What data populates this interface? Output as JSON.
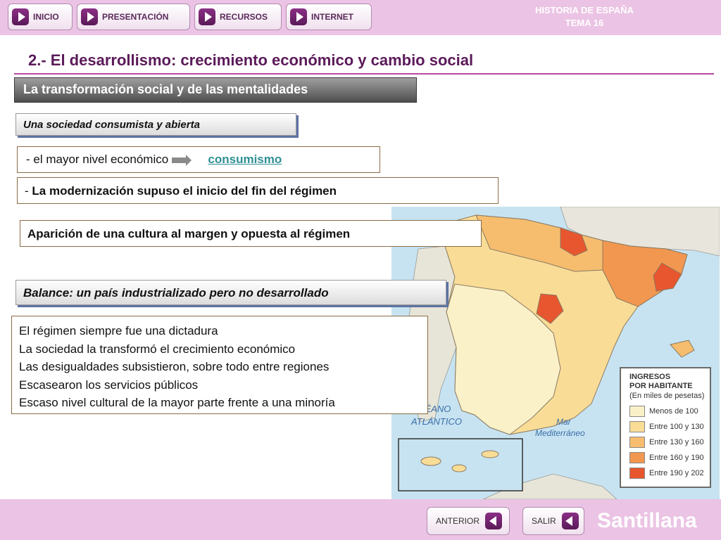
{
  "nav": {
    "buttons": [
      "INICIO",
      "PRESENTACIÓN",
      "RECURSOS",
      "INTERNET"
    ],
    "title_line1": "HISTORIA DE ESPAÑA",
    "title_line2": "TEMA 16"
  },
  "page": {
    "heading": "2.- El desarrollismo: crecimiento económico y cambio social",
    "section_title": "La transformación social y de las mentalidades",
    "subsection_1": "Una sociedad consumista y abierta",
    "line1_prefix": "- el mayor nivel económico",
    "line1_link": "consumismo",
    "line2_prefix": "- ",
    "line2_text": "La modernización  supuso el inicio del fin del régimen",
    "line3": "Aparición de una cultura al margen y opuesta al régimen",
    "subsection_2": "Balance: un país industrializado pero no desarrollado",
    "balance_items": [
      "El régimen siempre fue una dictadura",
      "La sociedad la transformó el crecimiento económico",
      "Las desigualdades subsistieron, sobre todo entre regiones",
      "Escasearon los servicios públicos",
      "Escaso nivel cultural de la mayor parte frente a una minoría"
    ]
  },
  "map": {
    "ocean_label_1": "OCÉANO",
    "ocean_label_2": "ATLÁNTICO",
    "sea_label_1": "Mar",
    "sea_label_2": "Mediterráneo",
    "legend": {
      "title_1": "INGRESOS",
      "title_2": "POR HABITANTE",
      "subtitle": "(En miles de pesetas)",
      "items": [
        {
          "label": "Menos de 100",
          "color": "#fbf1c9"
        },
        {
          "label": "Entre 100 y 130",
          "color": "#f9dc96"
        },
        {
          "label": "Entre 130 y 160",
          "color": "#f6bd6f"
        },
        {
          "label": "Entre 160 y 190",
          "color": "#f2974f"
        },
        {
          "label": "Entre 190 y 202",
          "color": "#e8562f"
        }
      ]
    }
  },
  "footer": {
    "prev_label": "ANTERIOR",
    "exit_label": "SALIR",
    "brand": "Santillana"
  },
  "colors": {
    "accent_purple": "#5b1a59",
    "bar_pink": "#ebc3e4",
    "link_teal": "#2f8f95"
  }
}
